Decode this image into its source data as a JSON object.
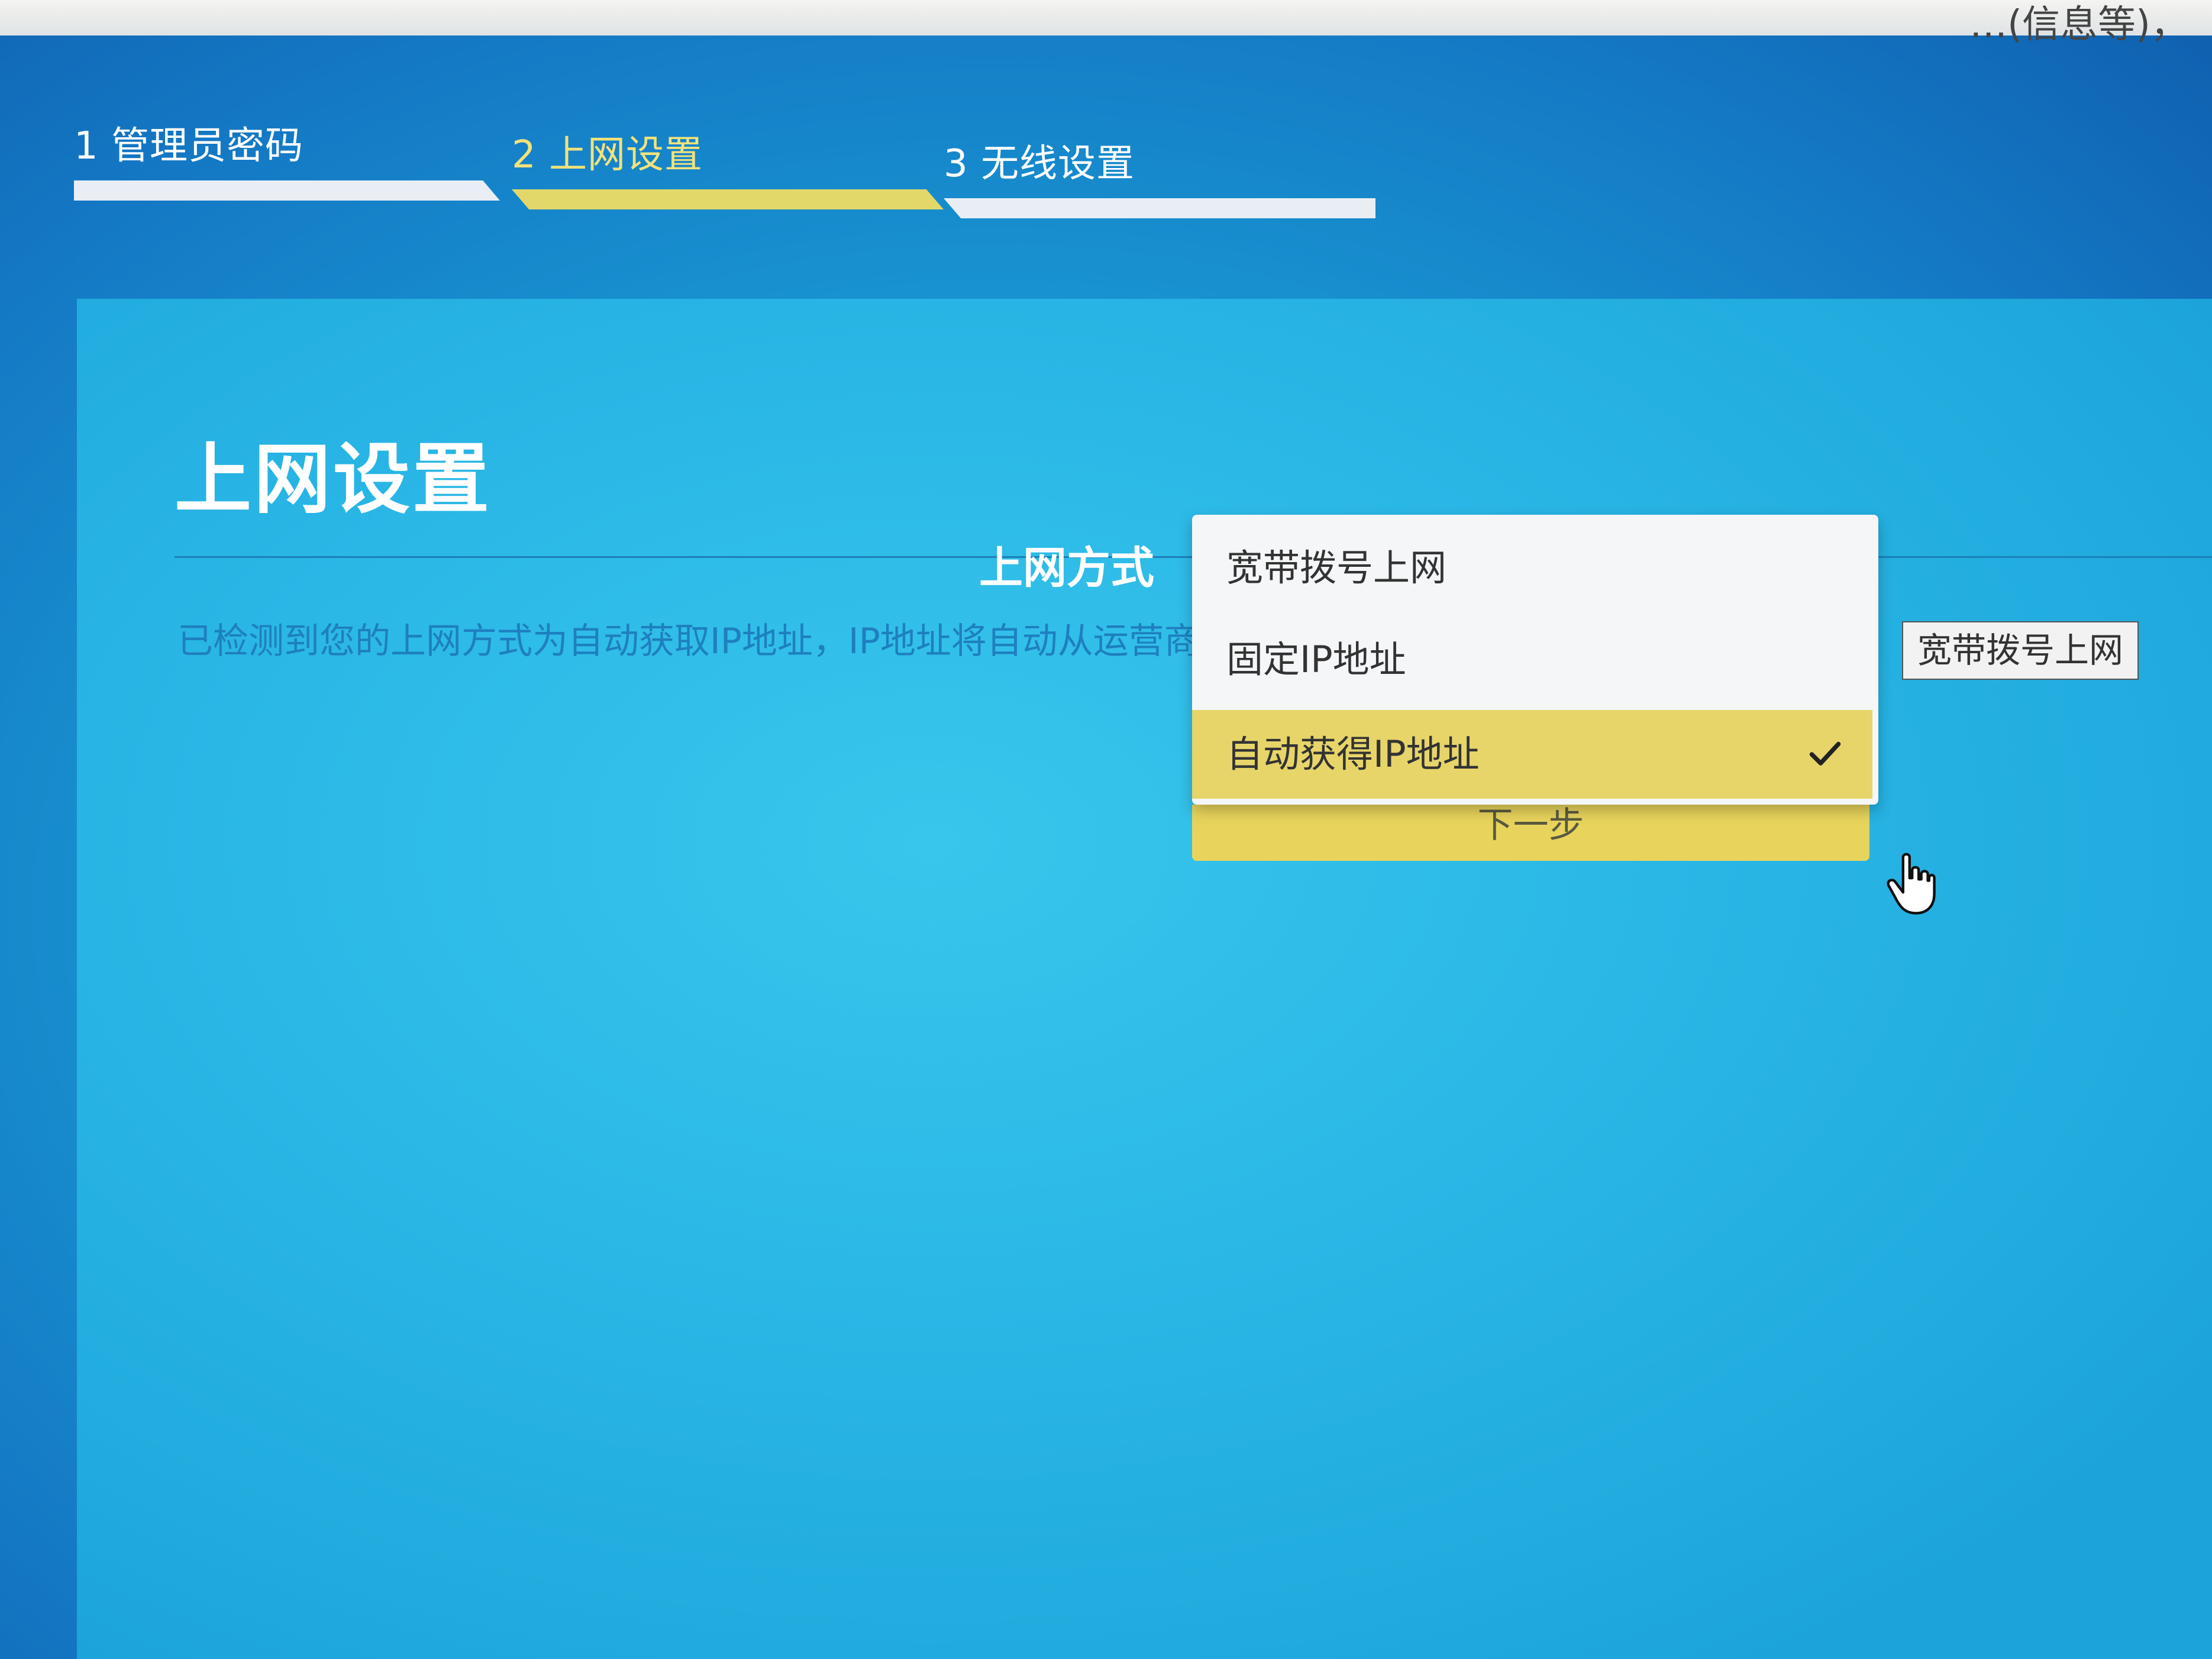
{
  "top_strip": {
    "text": "…(信息等)，"
  },
  "steps": [
    {
      "label": "1 管理员密码",
      "active": false
    },
    {
      "label": "2 上网设置",
      "active": true
    },
    {
      "label": "3 无线设置",
      "active": false
    }
  ],
  "panel": {
    "title": "上网设置",
    "description": "已检测到您的上网方式为自动获取IP地址，IP地址将自动从运营商处获取，请点击下一步继续。"
  },
  "form": {
    "field_label": "上网方式",
    "options": [
      {
        "label": "宽带拨号上网",
        "selected": false
      },
      {
        "label": "固定IP地址",
        "selected": false
      },
      {
        "label": "自动获得IP地址",
        "selected": true
      }
    ],
    "next_button": "下一步",
    "tooltip": "宽带拨号上网"
  },
  "colors": {
    "accent_yellow": "#e7d56a",
    "panel_blue": "#2ab7e6",
    "background_blue": "#1478c4"
  },
  "icons": {
    "check": "check-icon",
    "cursor": "hand-pointer-icon"
  }
}
